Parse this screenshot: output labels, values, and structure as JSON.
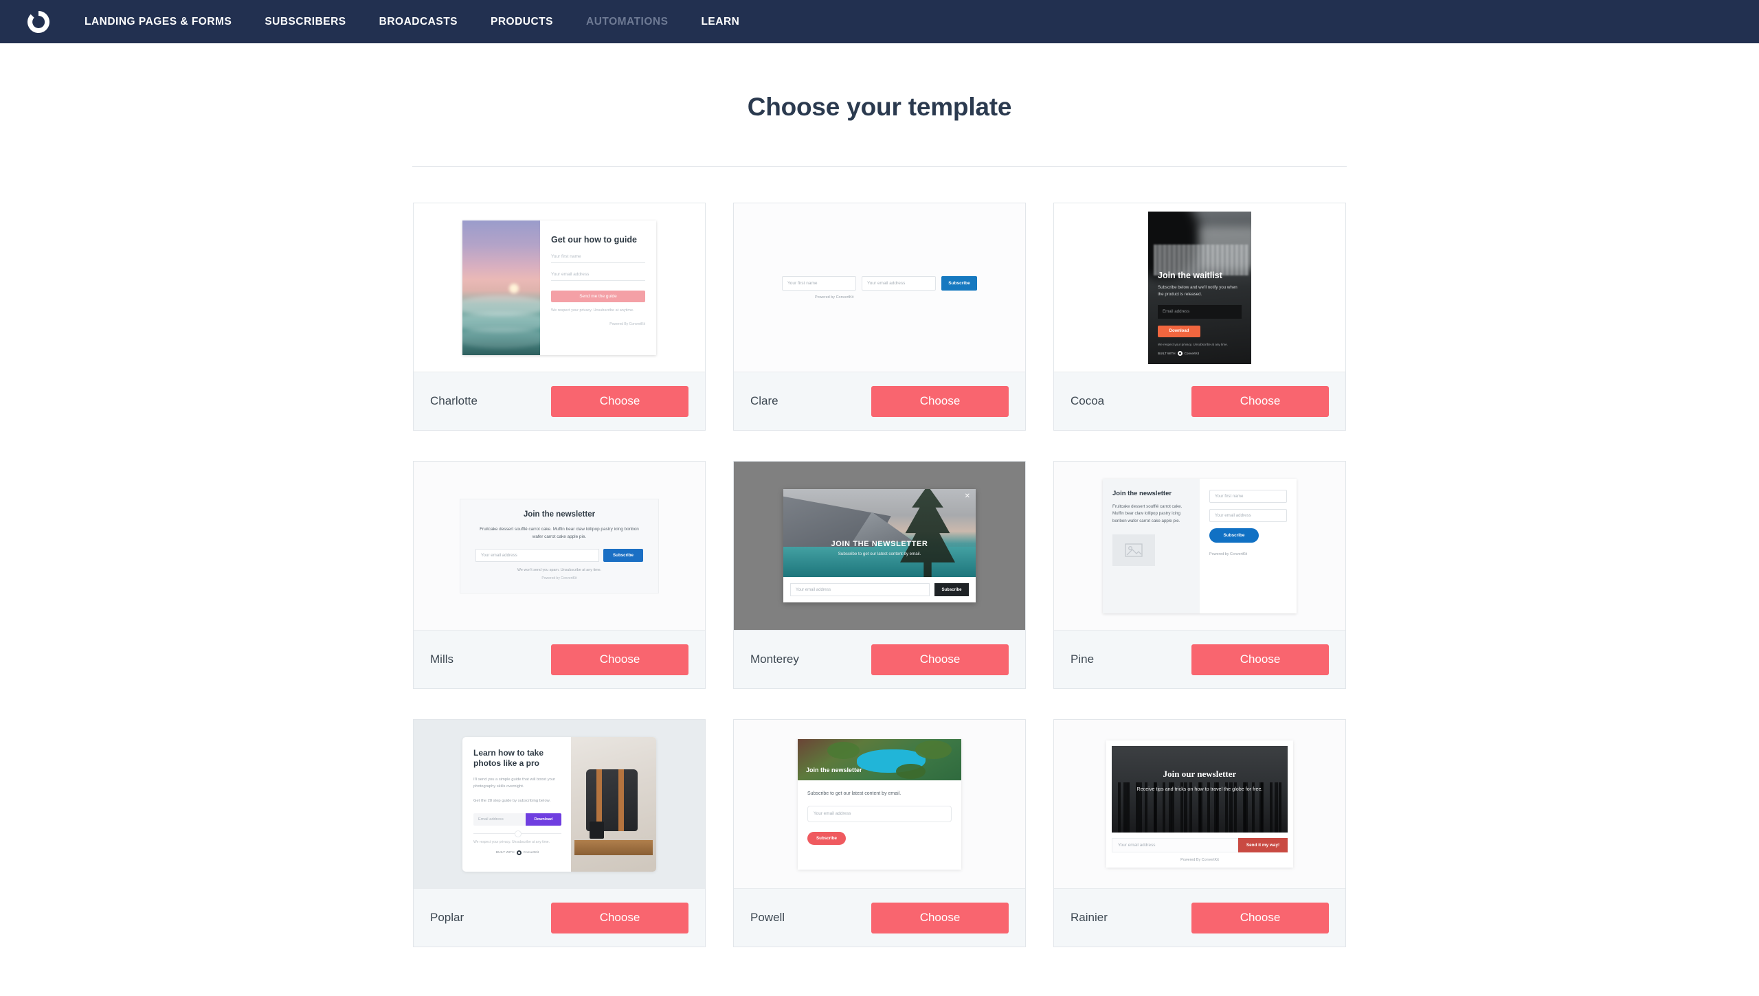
{
  "navbar": {
    "logo_icon": "convertkit-logo-icon",
    "links": [
      {
        "label": "LANDING PAGES & FORMS",
        "active": true
      },
      {
        "label": "SUBSCRIBERS",
        "active": true
      },
      {
        "label": "BROADCASTS",
        "active": true
      },
      {
        "label": "PRODUCTS",
        "active": true
      },
      {
        "label": "AUTOMATIONS",
        "active": false
      },
      {
        "label": "LEARN",
        "active": true
      }
    ]
  },
  "page": {
    "title": "Choose your template"
  },
  "choose_label": "Choose",
  "templates": {
    "charlotte": {
      "name": "Charlotte",
      "heading": "Get our how to guide",
      "first_name_placeholder": "Your first name",
      "email_placeholder": "Your email address",
      "button": "Send me the guide",
      "note": "We respect your privacy. Unsubscribe at anytime.",
      "powered": "Powered By ConvertKit"
    },
    "clare": {
      "name": "Clare",
      "first_name_placeholder": "Your first name",
      "email_placeholder": "Your email address",
      "button": "Subscribe",
      "powered": "Powered by ConvertKit"
    },
    "cocoa": {
      "name": "Cocoa",
      "heading": "Join the waitlist",
      "subtext": "Subscribe below and we'll notify you when the product is released.",
      "email_placeholder": "Email address",
      "button": "Download",
      "note": "We respect your privacy. Unsubscribe at any time.",
      "powered": "BUILT WITH",
      "powered_brand": "ConvertKit"
    },
    "mills": {
      "name": "Mills",
      "heading": "Join the newsletter",
      "body": "Fruitcake dessert soufflé carrot cake. Muffin bear claw lollipop pastry icing bonbon wafer carrot cake apple pie.",
      "email_placeholder": "Your email address",
      "button": "Subscribe",
      "note": "We won't send you spam. Unsubscribe at any time.",
      "powered": "Powered by ConvertKit"
    },
    "monterey": {
      "name": "Monterey",
      "heading": "JOIN THE NEWSLETTER",
      "subtext": "Subscribe to get our latest content by email.",
      "email_placeholder": "Your email address",
      "button": "Subscribe",
      "close_icon": "close-icon"
    },
    "pine": {
      "name": "Pine",
      "heading": "Join the newsletter",
      "body": "Fruitcake dessert soufflé carrot cake. Muffin bear claw lollipop pastry icing bonbon wafer carrot cake apple pie.",
      "first_name_placeholder": "Your first name",
      "email_placeholder": "Your email address",
      "button": "Subscribe",
      "powered": "Powered by ConvertKit",
      "image_placeholder_icon": "image-placeholder-icon"
    },
    "poplar": {
      "name": "Poplar",
      "heading": "Learn how to take photos like a pro",
      "body1": "I'll send you a simple guide that will boost your photography skills overnight.",
      "body2": "Get the 28 step guide by subscribing below.",
      "email_placeholder": "Email address",
      "button": "Download",
      "note": "We respect your privacy. Unsubscribe at any time.",
      "powered": "BUILT WITH",
      "powered_brand": "ConvertKit"
    },
    "powell": {
      "name": "Powell",
      "heading": "Join the newsletter",
      "subtext": "Subscribe to get our latest content by email.",
      "email_placeholder": "Your email address",
      "button": "Subscribe"
    },
    "rainier": {
      "name": "Rainier",
      "heading": "Join our newsletter",
      "subtext": "Receive tips and tricks on how to travel the globe for free.",
      "email_placeholder": "Your email address",
      "button": "Send it my way!",
      "powered": "Powered By ConvertKit"
    }
  },
  "colors": {
    "navbar": "#223050",
    "accent_coral": "#f9656f",
    "blue": "#1679c0",
    "orange": "#f1663f",
    "purple": "#6f3ee0",
    "red": "#c94a42"
  }
}
